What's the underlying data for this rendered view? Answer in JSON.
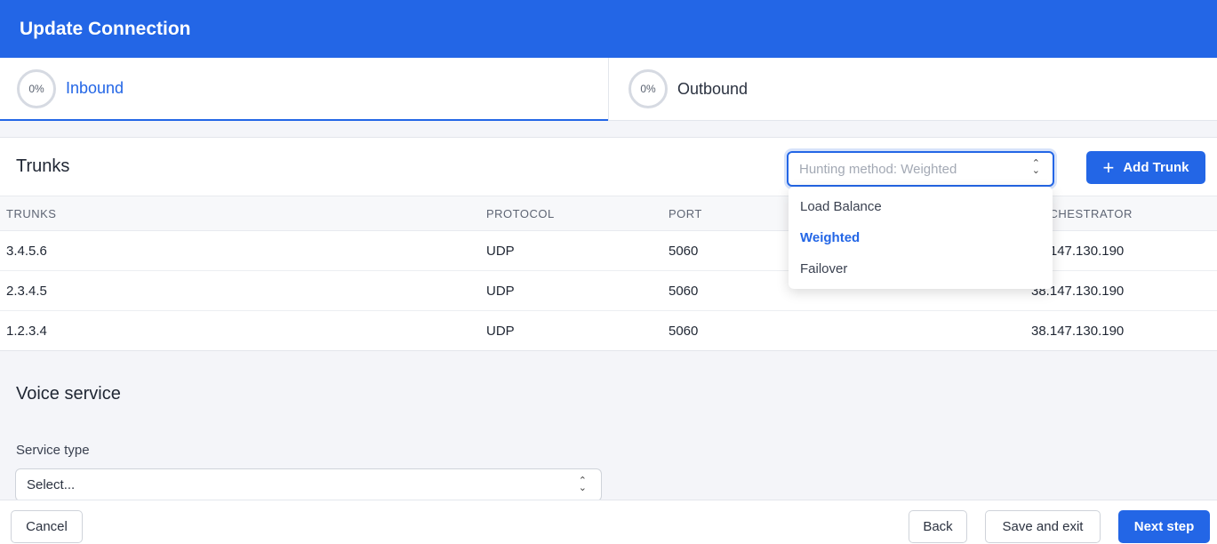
{
  "header": {
    "title": "Update Connection"
  },
  "tabs": [
    {
      "progress": "0%",
      "label": "Inbound",
      "active": true
    },
    {
      "progress": "0%",
      "label": "Outbound",
      "active": false
    }
  ],
  "trunks": {
    "title": "Trunks",
    "hunting_method": "Hunting method: Weighted",
    "add_label": "Add Trunk",
    "columns": [
      "TRUNKS",
      "PROTOCOL",
      "PORT",
      "ORCHESTRATOR"
    ],
    "rows": [
      [
        "3.4.5.6",
        "UDP",
        "5060",
        "38.147.130.190"
      ],
      [
        "2.3.4.5",
        "UDP",
        "5060",
        "38.147.130.190"
      ],
      [
        "1.2.3.4",
        "UDP",
        "5060",
        "38.147.130.190"
      ]
    ],
    "dropdown": {
      "options": [
        "Load Balance",
        "Weighted",
        "Failover"
      ],
      "selected": "Weighted"
    }
  },
  "voice": {
    "title": "Voice service",
    "service_type_label": "Service type",
    "service_type_value": "Select..."
  },
  "footer": {
    "cancel": "Cancel",
    "back": "Back",
    "save_exit": "Save and exit",
    "next": "Next step"
  },
  "colors": {
    "accent": "#2366e6"
  }
}
